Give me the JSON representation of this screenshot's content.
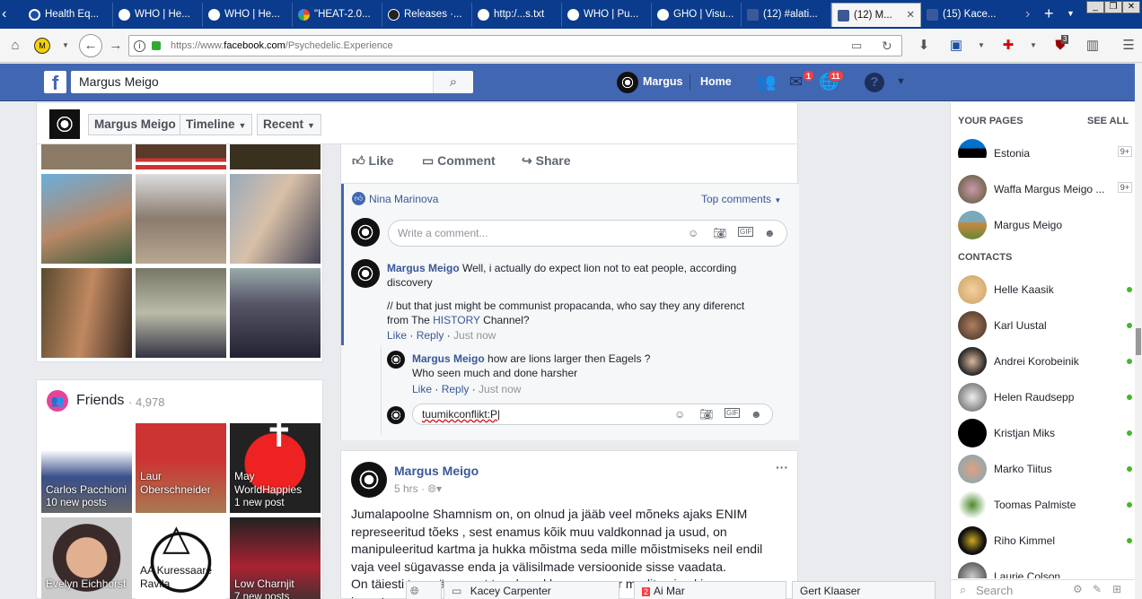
{
  "browser": {
    "tabs": [
      {
        "title": "Health Eq..."
      },
      {
        "title": "WHO | He..."
      },
      {
        "title": "WHO | He..."
      },
      {
        "title": "\"HEAT-2.0..."
      },
      {
        "title": "Releases ·..."
      },
      {
        "title": "http:/...s.txt"
      },
      {
        "title": "WHO | Pu..."
      },
      {
        "title": "GHO | Visu..."
      },
      {
        "title": "(12) #alati..."
      },
      {
        "title": "(12) M..."
      },
      {
        "title": "(15) Kace..."
      }
    ],
    "url_prefix": "https://www.",
    "url_domain": "facebook.com",
    "url_path": "/Psychedelic.Experience",
    "addon_badge": "3"
  },
  "fb_header": {
    "search_value": "Margus Meigo",
    "user_name": "Margus",
    "home_label": "Home",
    "messages_badge": "1",
    "notifications_badge": "11",
    "help_icon": "?"
  },
  "profile_bar": {
    "name_label": "Margus Meigo",
    "timeline_label": "Timeline",
    "recent_label": "Recent"
  },
  "friends": {
    "title": "Friends",
    "count": "· 4,978",
    "items": [
      {
        "name": "Carlos Pacchioni",
        "sub": "10 new posts"
      },
      {
        "name": "Laur Oberschneider",
        "sub": ""
      },
      {
        "name": "May WorldHappies",
        "sub": "1 new post"
      },
      {
        "name": "Evelyn Eichhorst",
        "sub": ""
      },
      {
        "name": "AA Kuressaare Ravila",
        "sub": ""
      },
      {
        "name": "Low Charnjit",
        "sub": "7 new posts"
      }
    ]
  },
  "post1": {
    "like_label": "Like",
    "comment_label": "Comment",
    "share_label": "Share",
    "reactor": "Nina Marinova",
    "sort_label": "Top comments",
    "comment_placeholder": "Write a comment...",
    "comment1": {
      "author": "Margus Meigo",
      "text": "Well, i actually do expect lion not to eat people, according discovery",
      "text2_pre": "// but that just might be communist propacanda, who say they any diferenct from The",
      "text2_link": "HISTORY",
      "text2_post": "Channel?",
      "like": "Like",
      "reply": "Reply",
      "time": "Just now"
    },
    "reply1": {
      "author": "Margus Meigo",
      "text": "how are lions larger then Eagels ?",
      "text2": "Who seen much and done harsher",
      "like": "Like",
      "reply": "Reply",
      "time": "Just now"
    },
    "reply_input_value": "tuumikconflikt:P"
  },
  "post2": {
    "author": "Margus Meigo",
    "time": "5 hrs",
    "menu": "···",
    "text": "Jumalapoolne Shamnism on, on olnud ja jääb veel mõneks ajaks ENIM represeeritud tõeks , sest enamus kõik muu valdkonnad ja usud, on manipuleeritud kartma ja hukka mõistma seda mille mõistmiseks neil endil vaja veel sügavasse enda ja välisilmade versioonide sisse vaadata.",
    "text_cut": "On täiesti tavapärane, et tegelased kes pooruvur meditserived ja isegatavad  ja hinnaerilikud"
  },
  "chat_tabs": [
    {
      "name": "Kacey Carpenter"
    },
    {
      "name": "Ai Mar",
      "badge": "2"
    },
    {
      "name": "Gert Klaaser"
    }
  ],
  "sidebar": {
    "your_pages_title": "YOUR PAGES",
    "see_all": "SEE ALL",
    "pages": [
      {
        "name": "Estonia",
        "count": "9+"
      },
      {
        "name": "Waffa Margus Meigo ...",
        "count": "9+"
      },
      {
        "name": "Margus Meigo",
        "count": ""
      }
    ],
    "contacts_title": "CONTACTS",
    "contacts": [
      {
        "name": "Helle Kaasik"
      },
      {
        "name": "Karl Uustal"
      },
      {
        "name": "Andrei Korobeinik"
      },
      {
        "name": "Helen Raudsepp"
      },
      {
        "name": "Kristjan Miks"
      },
      {
        "name": "Marko Tiitus"
      },
      {
        "name": "Toomas Palmiste"
      },
      {
        "name": "Riho Kimmel"
      },
      {
        "name": "Laurie Colson"
      }
    ],
    "search_placeholder": "Search"
  }
}
